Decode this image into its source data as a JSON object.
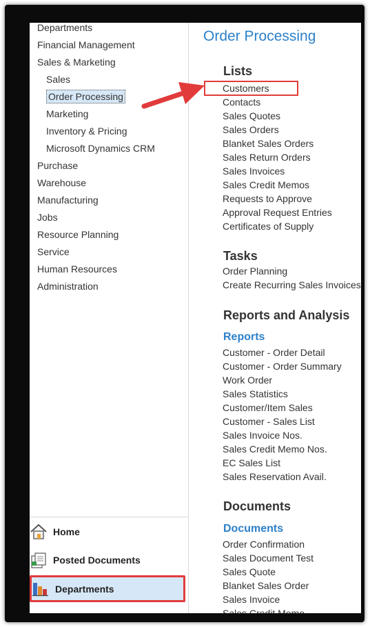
{
  "nav": {
    "items": [
      {
        "label": "Departments",
        "level": 0
      },
      {
        "label": "Financial Management",
        "level": 0
      },
      {
        "label": "Sales & Marketing",
        "level": 0
      },
      {
        "label": "Sales",
        "level": 1
      },
      {
        "label": "Order Processing",
        "level": 1,
        "selected": true
      },
      {
        "label": "Marketing",
        "level": 1
      },
      {
        "label": "Inventory & Pricing",
        "level": 1
      },
      {
        "label": "Microsoft Dynamics CRM",
        "level": 1
      },
      {
        "label": "Purchase",
        "level": 0
      },
      {
        "label": "Warehouse",
        "level": 0
      },
      {
        "label": "Manufacturing",
        "level": 0
      },
      {
        "label": "Jobs",
        "level": 0
      },
      {
        "label": "Resource Planning",
        "level": 0
      },
      {
        "label": "Service",
        "level": 0
      },
      {
        "label": "Human Resources",
        "level": 0
      },
      {
        "label": "Administration",
        "level": 0
      }
    ],
    "bottom": {
      "home": "Home",
      "posted": "Posted Documents",
      "departments": "Departments"
    }
  },
  "main": {
    "title": "Order Processing",
    "lists_heading": "Lists",
    "lists": [
      "Customers",
      "Contacts",
      "Sales Quotes",
      "Sales Orders",
      "Blanket Sales Orders",
      "Sales Return Orders",
      "Sales Invoices",
      "Sales Credit Memos",
      "Requests to Approve",
      "Approval Request Entries",
      "Certificates of Supply"
    ],
    "tasks_heading": "Tasks",
    "tasks": [
      "Order Planning",
      "Create Recurring Sales Invoices"
    ],
    "reports_heading": "Reports and Analysis",
    "reports_sub": "Reports",
    "reports": [
      "Customer - Order Detail",
      "Customer - Order Summary",
      "Work Order",
      "Sales Statistics",
      "Customer/Item Sales",
      "Customer - Sales List",
      "Sales Invoice Nos.",
      "Sales Credit Memo Nos.",
      "EC Sales List",
      "Sales Reservation Avail."
    ],
    "documents_heading": "Documents",
    "documents_sub": "Documents",
    "documents": [
      "Order Confirmation",
      "Sales Document Test",
      "Sales Quote",
      "Blanket Sales Order",
      "Sales Invoice",
      "Sales Credit Memo"
    ]
  },
  "colors": {
    "accent": "#2c80c9",
    "highlight": "#e23b3b",
    "selection": "#d6e8f7"
  },
  "icons": [
    "home-icon",
    "posted-documents-icon",
    "departments-icon",
    "arrow-icon"
  ]
}
